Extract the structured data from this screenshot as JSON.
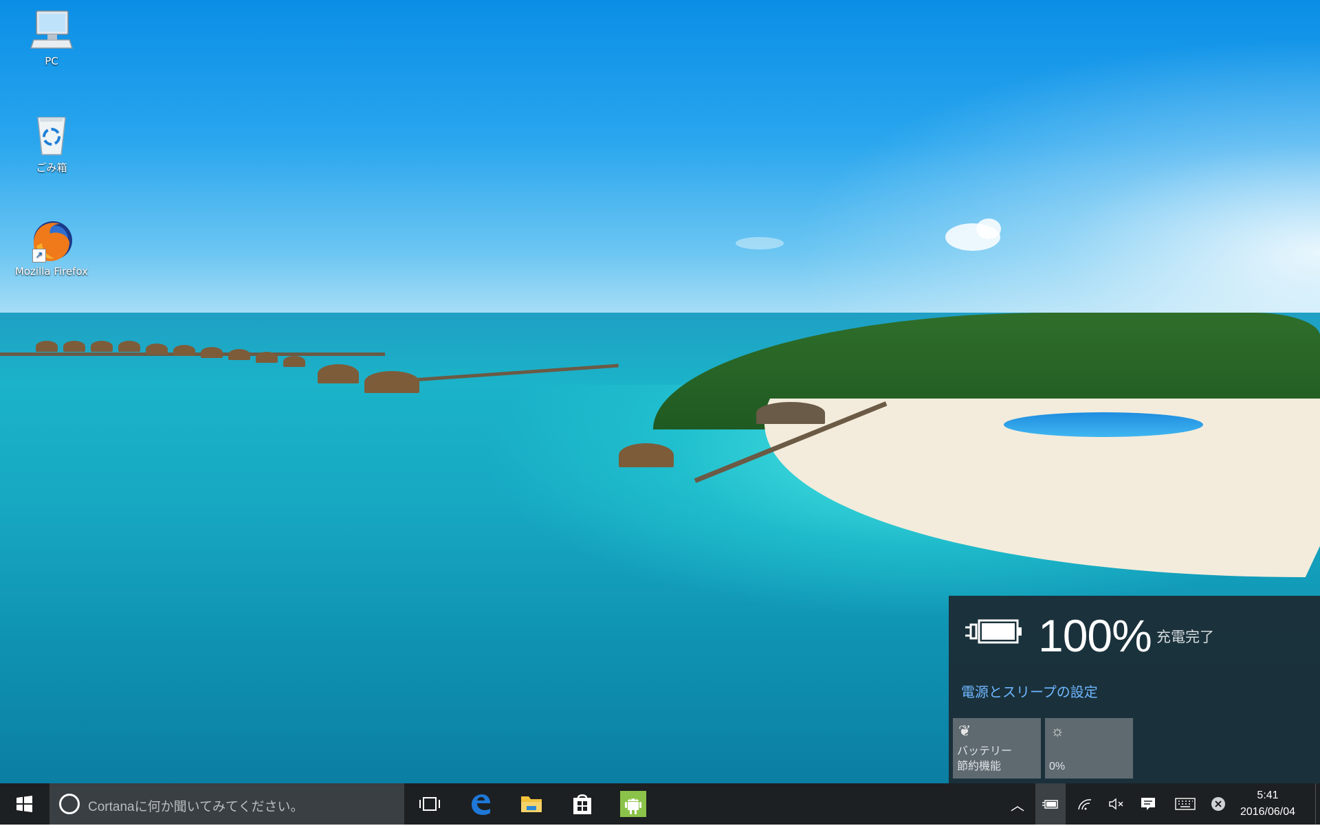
{
  "desktop": {
    "icons": [
      {
        "label": "PC"
      },
      {
        "label": "ごみ箱"
      },
      {
        "label": "Mozilla Firefox"
      }
    ]
  },
  "battery_flyout": {
    "percent": "100%",
    "status": "充電完了",
    "settings_link": "電源とスリープの設定",
    "tiles": [
      {
        "label_line1": "バッテリー",
        "label_line2": "節約機能",
        "icon": "leaf-icon"
      },
      {
        "label_line1": "0%",
        "icon": "brightness-icon"
      }
    ]
  },
  "taskbar": {
    "search_placeholder": "Cortanaに何か聞いてみてください。",
    "pinned": [
      {
        "name": "task-view",
        "icon": "task-view-icon"
      },
      {
        "name": "edge",
        "icon": "edge-icon",
        "color": "#1e78d7"
      },
      {
        "name": "file-explorer",
        "icon": "folder-icon",
        "color": "#f2c23c"
      },
      {
        "name": "store",
        "icon": "store-icon"
      },
      {
        "name": "android",
        "icon": "android-icon",
        "color": "#8bc34a"
      }
    ],
    "clock": {
      "time": "5:41",
      "date": "2016/06/04"
    }
  }
}
